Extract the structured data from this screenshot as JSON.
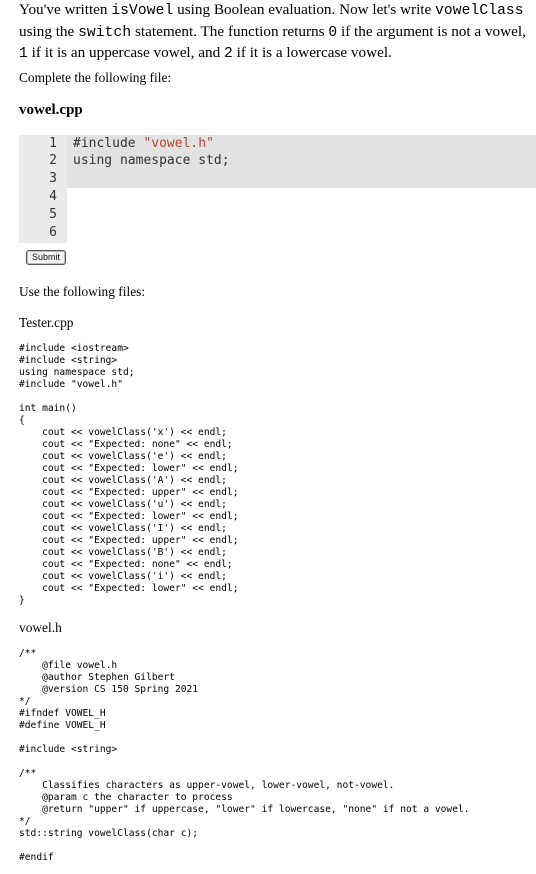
{
  "intro": {
    "t1": "You've written ",
    "c1": "isVowel",
    "t2": " using Boolean evaluation. Now let's write ",
    "c2": "vowelClass",
    "t3": " using the ",
    "c3": "switch",
    "t4": " statement. The function returns ",
    "c4": "0",
    "t5": " if the argument is not a vowel, ",
    "c5": "1",
    "t6": " if it is an uppercase vowel, and ",
    "c6": "2",
    "t7": " if it is a lowercase vowel."
  },
  "complete_text": "Complete the following file:",
  "editor": {
    "filename": "vowel.cpp",
    "line_numbers": [
      "1",
      "2",
      "3",
      "4",
      "5",
      "6"
    ],
    "line1_code": "#include ",
    "line1_string": "\"vowel.h\"",
    "line2_code": "using namespace std;"
  },
  "submit_label": "Submit",
  "use_text": "Use the following files:",
  "files": {
    "tester_name": "Tester.cpp",
    "tester_source": "#include <iostream>\n#include <string>\nusing namespace std;\n#include \"vowel.h\"\n\nint main()\n{\n    cout << vowelClass('x') << endl;\n    cout << \"Expected: none\" << endl;\n    cout << vowelClass('e') << endl;\n    cout << \"Expected: lower\" << endl;\n    cout << vowelClass('A') << endl;\n    cout << \"Expected: upper\" << endl;\n    cout << vowelClass('u') << endl;\n    cout << \"Expected: lower\" << endl;\n    cout << vowelClass('I') << endl;\n    cout << \"Expected: upper\" << endl;\n    cout << vowelClass('B') << endl;\n    cout << \"Expected: none\" << endl;\n    cout << vowelClass('i') << endl;\n    cout << \"Expected: lower\" << endl;\n}",
    "header_name": "vowel.h",
    "header_source": "/**\n    @file vowel.h\n    @author Stephen Gilbert\n    @version CS 150 Spring 2021\n*/\n#ifndef VOWEL_H\n#define VOWEL_H\n\n#include <string>\n\n/**\n    Classifies characters as upper-vowel, lower-vowel, not-vowel.\n    @param c the character to process\n    @return \"upper\" if uppercase, \"lower\" if lowercase, \"none\" if not a vowel.\n*/\nstd::string vowelClass(char c);\n\n#endif"
  }
}
